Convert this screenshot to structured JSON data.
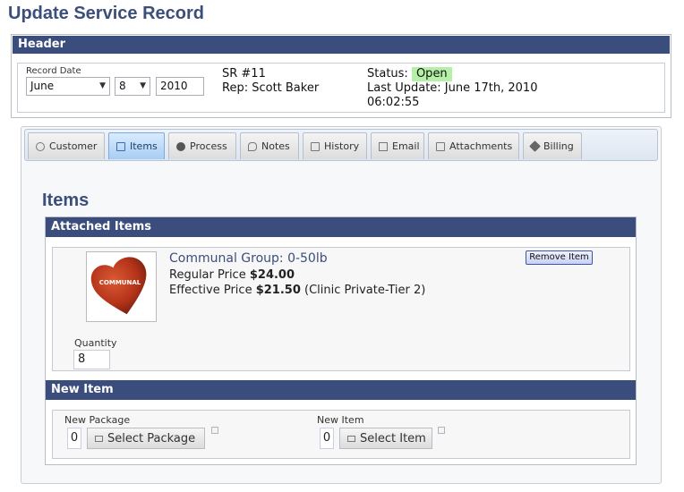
{
  "page": {
    "title": "Update Service Record"
  },
  "header": {
    "bar_label": "Header",
    "record_date_label": "Record Date",
    "month": "June",
    "day": "8",
    "year": "2010",
    "sr_number": "SR #11",
    "rep": "Rep: Scott Baker",
    "status_label": "Status:",
    "status_value": "Open",
    "last_update": "Last Update: June 17th, 2010",
    "last_update_time": "06:02:55"
  },
  "tabs": [
    {
      "label": "Customer",
      "icon": "person-icon"
    },
    {
      "label": "Items",
      "icon": "items-icon",
      "active": true
    },
    {
      "label": "Process",
      "icon": "clock-icon"
    },
    {
      "label": "Notes",
      "icon": "notes-icon"
    },
    {
      "label": "History",
      "icon": "history-icon"
    },
    {
      "label": "Email",
      "icon": "email-icon"
    },
    {
      "label": "Attachments",
      "icon": "attachment-icon"
    },
    {
      "label": "Billing",
      "icon": "tag-icon"
    }
  ],
  "items": {
    "heading": "Items",
    "attached_bar": "Attached Items",
    "item": {
      "name": "Communal Group: 0-50lb",
      "thumb_text": "COMMUNAL",
      "regular_label": "Regular Price",
      "regular_price": "$24.00",
      "effective_label": "Effective Price",
      "effective_price": "$21.50",
      "effective_note": "(Clinic Private-Tier 2)",
      "remove_label": "Remove Item",
      "quantity_label": "Quantity",
      "quantity": "8"
    },
    "new_bar": "New Item",
    "new_package_label": "New Package",
    "new_package_count": "0",
    "select_package_label": "Select Package",
    "new_item_label": "New Item",
    "new_item_count": "0",
    "select_item_label": "Select Item"
  },
  "colors": {
    "accent_bar": "#3a4d7c",
    "status_open": "#b5f0a8",
    "heart": "#b5341a"
  }
}
